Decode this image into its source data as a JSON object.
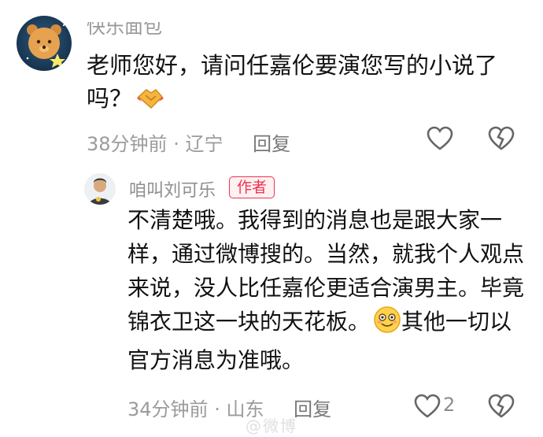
{
  "comment1": {
    "username": "快乐面包",
    "text": "老师您好，请问任嘉伦要演您写的小说了吗？",
    "time": "38分钟前",
    "location": "辽宁",
    "reply_label": "回复"
  },
  "comment2": {
    "username": "咱叫刘可乐",
    "author_tag": "作者",
    "text": "不清楚哦。我得到的消息也是跟大家一样，通过微博搜的。当然，就我个人观点来说，没人比任嘉伦更适合演男主。毕竟锦衣卫这一块的天花板。",
    "text_after_emoji": "其他一切以官方消息为准哦。",
    "time": "34分钟前",
    "location": "山东",
    "reply_label": "回复",
    "like_count": "2"
  },
  "watermark": "@微博",
  "colors": {
    "author_tag": "#ee3350",
    "meta": "#9b9b9b"
  },
  "icons": [
    "bear-avatar",
    "handshake-emoji",
    "heart-icon",
    "broken-heart-icon",
    "smile-emoji"
  ]
}
